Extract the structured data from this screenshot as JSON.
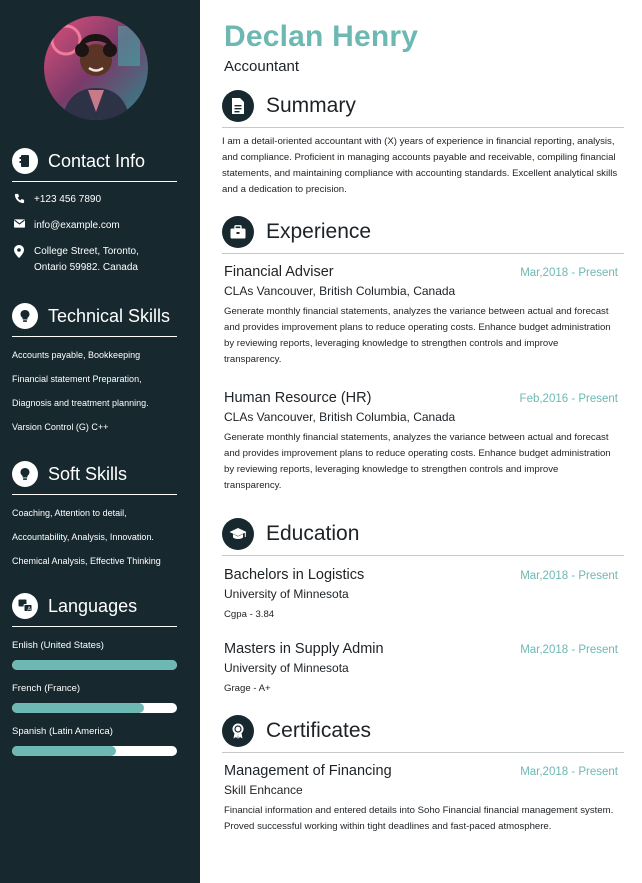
{
  "profile": {
    "name": "Declan Henry",
    "role": "Accountant"
  },
  "sidebar": {
    "contact": {
      "title": "Contact Info",
      "phone": "+123 456 7890",
      "email": "info@example.com",
      "address_line1": "College Street, Toronto,",
      "address_line2": "Ontario 59982. Canada"
    },
    "technical": {
      "title": "Technical Skills",
      "items": [
        "Accounts payable, Bookkeeping",
        "Financial statement Preparation,",
        "Diagnosis and treatment planning.",
        "Varsion Control (G) C++"
      ]
    },
    "soft": {
      "title": "Soft Skills",
      "items": [
        "Coaching, Attention to detail,",
        "Accountability, Analysis, Innovation.",
        "Chemical Analysis, Effective Thinking"
      ]
    },
    "languages": {
      "title": "Languages",
      "items": [
        {
          "name": "Enlish (United States)",
          "level": 1.0
        },
        {
          "name": "French (France)",
          "level": 0.8
        },
        {
          "name": "Spanish (Latin America)",
          "level": 0.63
        }
      ]
    }
  },
  "summary": {
    "title": "Summary",
    "text": "I am a detail-oriented accountant with (X) years of experience in financial reporting, analysis, and compliance. Proficient in managing accounts payable and receivable, compiling financial statements, and maintaining compliance with accounting standards. Excellent analytical skills and a dedication to precision."
  },
  "experience": {
    "title": "Experience",
    "items": [
      {
        "title": "Financial Adviser",
        "date": "Mar,2018 - Present",
        "org": "CLAs Vancouver, British Columbia, Canada",
        "desc": "Generate monthly financial statements, analyzes the variance between actual and forecast and provides improvement plans to reduce operating costs. Enhance budget administration by reviewing reports, leveraging knowledge to strengthen controls and improve transparency."
      },
      {
        "title": "Human Resource (HR)",
        "date": "Feb,2016 - Present",
        "org": "CLAs Vancouver, British Columbia, Canada",
        "desc": "Generate monthly financial statements, analyzes the variance between actual and forecast and provides improvement plans to reduce operating costs. Enhance budget administration by reviewing reports, leveraging knowledge to strengthen controls and improve transparency."
      }
    ]
  },
  "education": {
    "title": "Education",
    "items": [
      {
        "title": "Bachelors in Logistics",
        "date": "Mar,2018 - Present",
        "org": "University of Minnesota",
        "note": "Cgpa - 3.84"
      },
      {
        "title": "Masters in Supply Admin",
        "date": "Mar,2018 - Present",
        "org": "University of Minnesota",
        "note": "Grage - A+"
      }
    ]
  },
  "certificates": {
    "title": "Certificates",
    "items": [
      {
        "title": "Management of Financing",
        "date": "Mar,2018 - Present",
        "org": "Skill Enhcance",
        "desc": "Financial information and entered details into Soho Financial financial management system. Proved successful working within tight deadlines and fast-paced atmosphere."
      }
    ]
  },
  "colors": {
    "sidebar": "#17282f",
    "accent": "#6db8b3",
    "text": "#1d2226"
  }
}
